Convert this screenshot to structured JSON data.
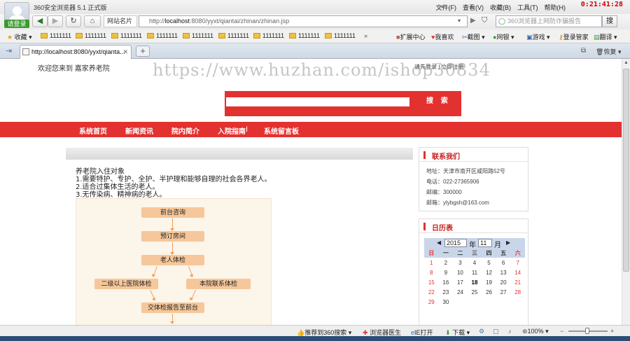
{
  "browser": {
    "app_title": "360安全浏览器 5.1 正式版",
    "login_label": "请登录",
    "menu": [
      "文件(F)",
      "查看(V)",
      "收藏(B)",
      "工具(T)",
      "帮助(H)"
    ],
    "clock": "0:21:41:28",
    "site_name": "网站名片",
    "url_prefix": "http://",
    "url_host": "localhost",
    "url_rest": ":8080/yyxt/qiantai/zhinan/zhinan.jsp",
    "search_placeholder": "360浏览器上网防诈骗报告",
    "search_button": "搜",
    "favorites_label": "收藏",
    "bookmarks": [
      "1111111",
      "1111111",
      "1111111",
      "1111111",
      "1111111",
      "1111111",
      "1111111",
      "1111111",
      "1111111",
      "1111111"
    ],
    "toolbar_right": [
      "扩展中心",
      "我喜欢",
      "截图",
      "网银",
      "游戏",
      "登录管家",
      "翻译"
    ],
    "tab_title": "http://localhost:8080/yyxt/qianta...",
    "restore_label": "恢复"
  },
  "page": {
    "welcome": "欢迎您来到 嘉家养老院",
    "top_links": "请先登录 | 立即注册",
    "watermark": "https://www.huzhan.com/ishop30834",
    "search_button": "搜 索",
    "nav": [
      "系统首页",
      "新闻资讯",
      "院内简介",
      "入院指南",
      "系统留言板"
    ],
    "content_lines": [
      "养老院入住对象",
      "1.需要特护、专护、全护、半护理和能够自理的社会各界老人。",
      "2.适合过集体生活的老人。",
      "3.无传染病、精神病的老人。"
    ],
    "flow": {
      "step1": "前台咨询",
      "step2": "预订房间",
      "step3": "老人体检",
      "left": "二级以上医院体检",
      "right": "本院联系体检",
      "step5": "交体检报告至前台"
    },
    "contact": {
      "title": "联系我们",
      "address": "地址：天津市南开区咸阳路52号",
      "phone": "电话：022-27365906",
      "postcode": "邮编：300000",
      "email": "邮箱：ylybgsh@163.com"
    },
    "calendar": {
      "title": "日历表",
      "year": "2015",
      "year_label": "年",
      "month": "11",
      "month_label": "月",
      "weekdays": [
        "日",
        "一",
        "二",
        "三",
        "四",
        "五",
        "六"
      ],
      "weeks": [
        [
          "1",
          "2",
          "3",
          "4",
          "5",
          "6",
          "7"
        ],
        [
          "8",
          "9",
          "10",
          "11",
          "12",
          "13",
          "14"
        ],
        [
          "15",
          "16",
          "17",
          "18",
          "19",
          "20",
          "21"
        ],
        [
          "22",
          "23",
          "24",
          "25",
          "26",
          "27",
          "28"
        ],
        [
          "29",
          "30",
          "",
          "",
          "",
          "",
          ""
        ]
      ]
    }
  },
  "status": {
    "recommend": "推荐到360搜索",
    "doctor": "浏览器医生",
    "ie": "IE打开",
    "download": "下载",
    "zoom": "100%"
  }
}
